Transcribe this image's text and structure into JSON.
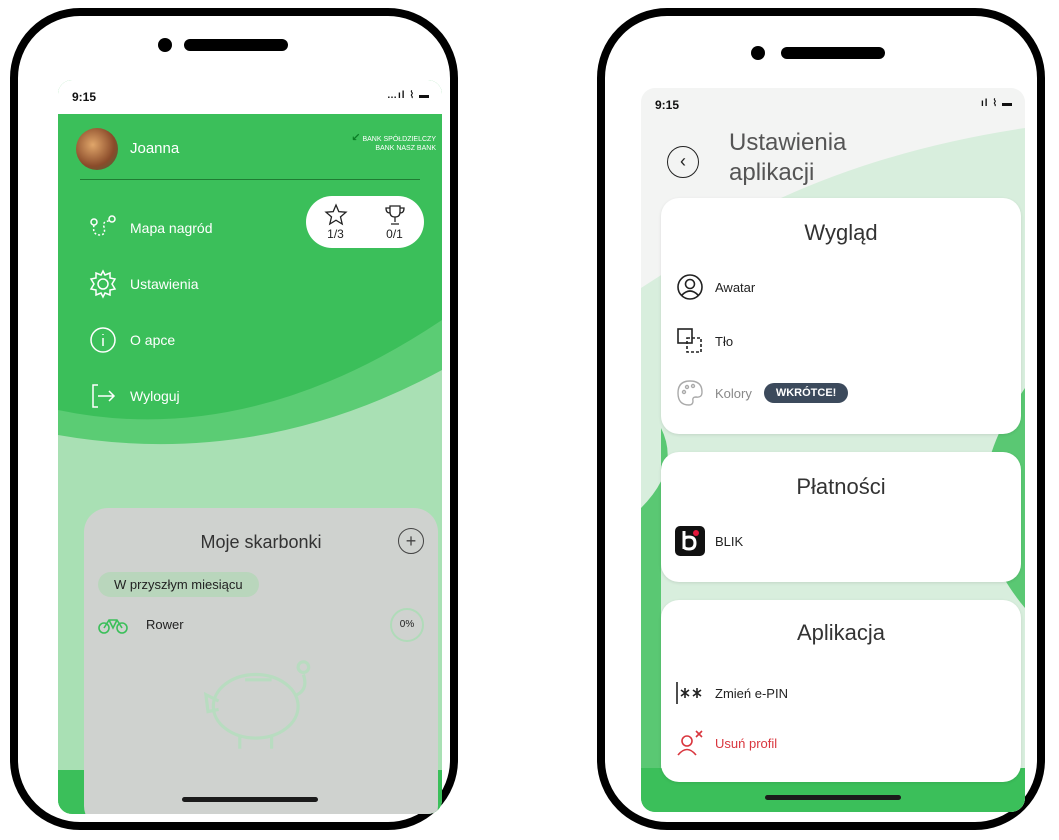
{
  "left_phone": {
    "status_bar": {
      "time": "9:15",
      "icons": "…ıl ⌇ ▬"
    },
    "header": {
      "user_name": "Joanna",
      "bank_line1": "BANK SPÓŁDZIELCZY",
      "bank_line2": "BANK   NASZ BANK"
    },
    "menu": [
      {
        "label": "Mapa nagród",
        "icon": "route-map-icon"
      },
      {
        "label": "Ustawienia",
        "icon": "gear-icon"
      },
      {
        "label": "O apce",
        "icon": "info-icon"
      },
      {
        "label": "Wyloguj",
        "icon": "logout-icon"
      }
    ],
    "stats": {
      "stars": "1/3",
      "trophies": "0/1"
    },
    "piggy": {
      "title": "Moje skarbonki",
      "period_chip": "W przyszłym miesiącu",
      "item_name": "Rower",
      "item_progress": "0%"
    }
  },
  "right_phone": {
    "status_bar": {
      "time": "9:15",
      "icons": "ıl ⌇ ▬"
    },
    "header": {
      "title_line1": "Ustawienia",
      "title_line2": "aplikacji"
    },
    "cards": {
      "wyglad": {
        "title": "Wygląd",
        "avatar": "Awatar",
        "background": "Tło",
        "colors": "Kolory",
        "soon_badge": "WKRÓTCE!"
      },
      "platnosci": {
        "title": "Płatności",
        "blik": "BLIK"
      },
      "aplikacja": {
        "title": "Aplikacja",
        "change_pin": "Zmień e-PIN",
        "remove_profile": "Usuń profil"
      }
    }
  },
  "colors": {
    "green": "#3bbf5a",
    "light_green": "#8fd89e",
    "danger": "#d9363e",
    "badge": "#3c4a5c"
  }
}
